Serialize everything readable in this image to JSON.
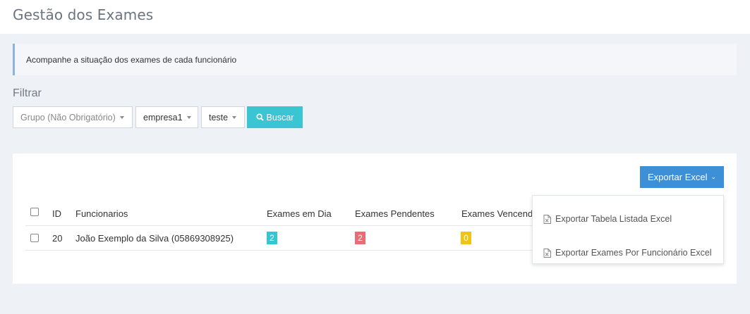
{
  "page": {
    "title": "Gestão dos Exames"
  },
  "note": {
    "text": "Acompanhe a situação dos exames de cada funcionário"
  },
  "filter": {
    "label": "Filtrar",
    "group_placeholder": "Grupo (Não Obrigatório)",
    "empresa_value": "empresa1",
    "teste_value": "teste",
    "search_label": "Buscar",
    "search_icon": "search-icon"
  },
  "export": {
    "button_label": "Exportar Excel",
    "menu": [
      {
        "label": "Exportar Tabela Listada Excel",
        "icon": "file-excel-icon"
      },
      {
        "label": "Exportar Exames Por Funcionário Excel",
        "icon": "file-excel-icon"
      }
    ]
  },
  "table": {
    "columns": [
      "ID",
      "Funcionarios",
      "Exames em Dia",
      "Exames Pendentes",
      "Exames Vencendo"
    ],
    "rows": [
      {
        "id": "20",
        "name": "João Exemplo da Silva (05869308925)",
        "em_dia": "2",
        "pendentes": "2",
        "vencendo": "0"
      }
    ]
  },
  "colors": {
    "accent": "#3d8fd6",
    "search": "#3ac5d3",
    "badge_em_dia": "#36c6d3",
    "badge_pendentes": "#ed6b75",
    "badge_vencendo": "#f1c40f"
  }
}
